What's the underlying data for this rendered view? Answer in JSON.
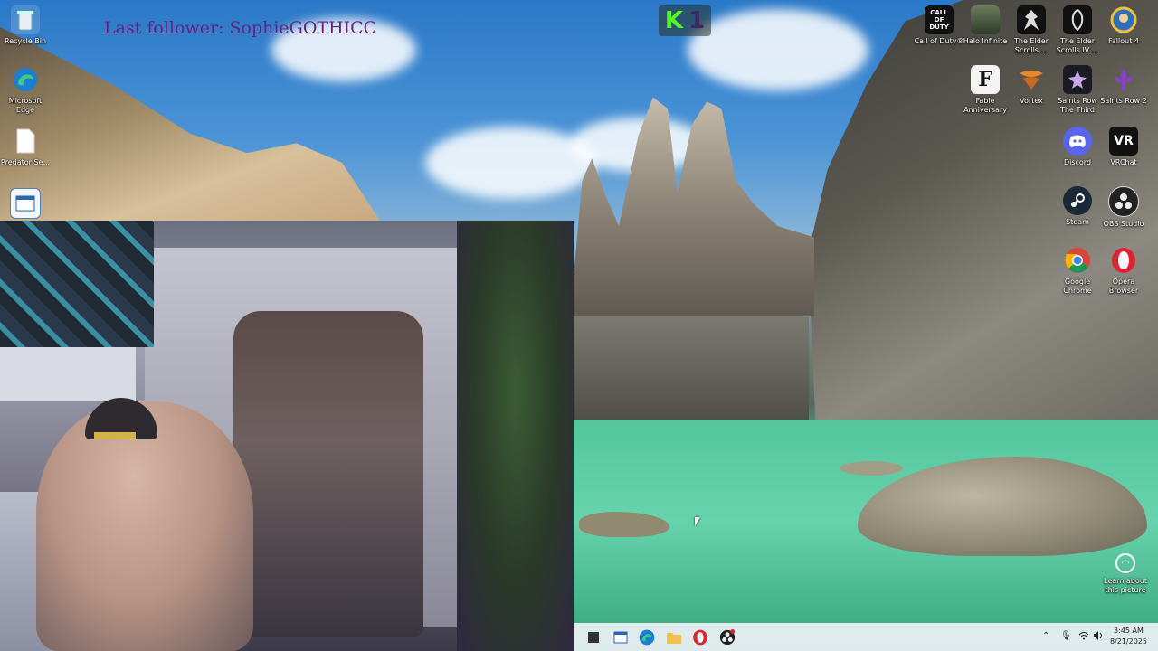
{
  "stream": {
    "last_follower": "Last follower: SophieGOTHICC",
    "kick_letter": "K",
    "kick_count": "1"
  },
  "desktop_icons_left": [
    {
      "label": "Recycle Bin",
      "icon": "recycle-bin-icon"
    },
    {
      "label": "Microsoft Edge",
      "icon": "edge-icon"
    },
    {
      "label": "Predator Se...",
      "icon": "document-icon"
    },
    {
      "label": "",
      "icon": "window-app-icon"
    }
  ],
  "desktop_icons_right": [
    {
      "label": "Call of Duty®",
      "icon": "call-of-duty-icon",
      "glyph": "CALL OF DUTY"
    },
    {
      "label": "Halo Infinite",
      "icon": "halo-icon",
      "glyph": ""
    },
    {
      "label": "The Elder Scrolls ...",
      "icon": "elder-scrolls-icon",
      "glyph": ""
    },
    {
      "label": "The Elder Scrolls IV ...",
      "icon": "elder-scrolls-iv-icon",
      "glyph": ""
    },
    {
      "label": "Fallout 4",
      "icon": "fallout-icon",
      "glyph": ""
    },
    {
      "label": "Fable Anniversary",
      "icon": "fable-icon",
      "glyph": "F"
    },
    {
      "label": "Vortex",
      "icon": "vortex-icon",
      "glyph": ""
    },
    {
      "label": "Saints Row The Third",
      "icon": "saints-row-third-icon",
      "glyph": ""
    },
    {
      "label": "Saints Row 2",
      "icon": "saints-row-2-icon",
      "glyph": ""
    },
    {
      "label": "Discord",
      "icon": "discord-icon",
      "glyph": ""
    },
    {
      "label": "VRChat",
      "icon": "vrchat-icon",
      "glyph": "VR"
    },
    {
      "label": "Steam",
      "icon": "steam-icon",
      "glyph": ""
    },
    {
      "label": "OBS Studio",
      "icon": "obs-icon",
      "glyph": ""
    },
    {
      "label": "Google Chrome",
      "icon": "chrome-icon",
      "glyph": ""
    },
    {
      "label": "Opera Browser",
      "icon": "opera-icon",
      "glyph": ""
    }
  ],
  "learn_picture": {
    "label": "Learn about this picture"
  },
  "taskbar": {
    "clock_time": "3:45 AM",
    "clock_date": "8/21/2025"
  },
  "colors": {
    "follower_text": "#6a1f7e",
    "kick_green": "#53fc18",
    "taskbar_bg": "#ebf0f5"
  }
}
